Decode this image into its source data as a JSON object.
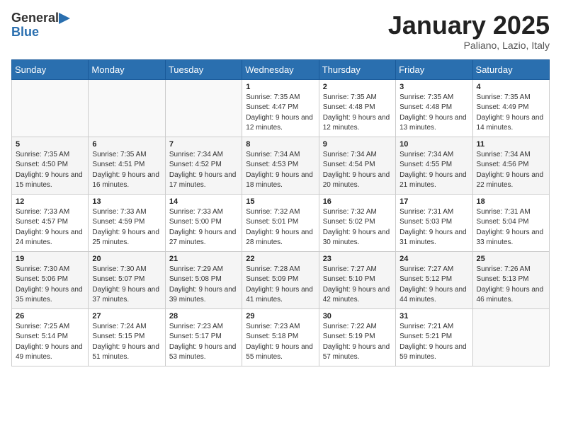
{
  "header": {
    "logo": {
      "general": "General",
      "blue": "Blue"
    },
    "title": "January 2025",
    "subtitle": "Paliano, Lazio, Italy"
  },
  "weekdays": [
    "Sunday",
    "Monday",
    "Tuesday",
    "Wednesday",
    "Thursday",
    "Friday",
    "Saturday"
  ],
  "weeks": [
    [
      {
        "day": "",
        "info": ""
      },
      {
        "day": "",
        "info": ""
      },
      {
        "day": "",
        "info": ""
      },
      {
        "day": "1",
        "info": "Sunrise: 7:35 AM\nSunset: 4:47 PM\nDaylight: 9 hours and 12 minutes."
      },
      {
        "day": "2",
        "info": "Sunrise: 7:35 AM\nSunset: 4:48 PM\nDaylight: 9 hours and 12 minutes."
      },
      {
        "day": "3",
        "info": "Sunrise: 7:35 AM\nSunset: 4:48 PM\nDaylight: 9 hours and 13 minutes."
      },
      {
        "day": "4",
        "info": "Sunrise: 7:35 AM\nSunset: 4:49 PM\nDaylight: 9 hours and 14 minutes."
      }
    ],
    [
      {
        "day": "5",
        "info": "Sunrise: 7:35 AM\nSunset: 4:50 PM\nDaylight: 9 hours and 15 minutes."
      },
      {
        "day": "6",
        "info": "Sunrise: 7:35 AM\nSunset: 4:51 PM\nDaylight: 9 hours and 16 minutes."
      },
      {
        "day": "7",
        "info": "Sunrise: 7:34 AM\nSunset: 4:52 PM\nDaylight: 9 hours and 17 minutes."
      },
      {
        "day": "8",
        "info": "Sunrise: 7:34 AM\nSunset: 4:53 PM\nDaylight: 9 hours and 18 minutes."
      },
      {
        "day": "9",
        "info": "Sunrise: 7:34 AM\nSunset: 4:54 PM\nDaylight: 9 hours and 20 minutes."
      },
      {
        "day": "10",
        "info": "Sunrise: 7:34 AM\nSunset: 4:55 PM\nDaylight: 9 hours and 21 minutes."
      },
      {
        "day": "11",
        "info": "Sunrise: 7:34 AM\nSunset: 4:56 PM\nDaylight: 9 hours and 22 minutes."
      }
    ],
    [
      {
        "day": "12",
        "info": "Sunrise: 7:33 AM\nSunset: 4:57 PM\nDaylight: 9 hours and 24 minutes."
      },
      {
        "day": "13",
        "info": "Sunrise: 7:33 AM\nSunset: 4:59 PM\nDaylight: 9 hours and 25 minutes."
      },
      {
        "day": "14",
        "info": "Sunrise: 7:33 AM\nSunset: 5:00 PM\nDaylight: 9 hours and 27 minutes."
      },
      {
        "day": "15",
        "info": "Sunrise: 7:32 AM\nSunset: 5:01 PM\nDaylight: 9 hours and 28 minutes."
      },
      {
        "day": "16",
        "info": "Sunrise: 7:32 AM\nSunset: 5:02 PM\nDaylight: 9 hours and 30 minutes."
      },
      {
        "day": "17",
        "info": "Sunrise: 7:31 AM\nSunset: 5:03 PM\nDaylight: 9 hours and 31 minutes."
      },
      {
        "day": "18",
        "info": "Sunrise: 7:31 AM\nSunset: 5:04 PM\nDaylight: 9 hours and 33 minutes."
      }
    ],
    [
      {
        "day": "19",
        "info": "Sunrise: 7:30 AM\nSunset: 5:06 PM\nDaylight: 9 hours and 35 minutes."
      },
      {
        "day": "20",
        "info": "Sunrise: 7:30 AM\nSunset: 5:07 PM\nDaylight: 9 hours and 37 minutes."
      },
      {
        "day": "21",
        "info": "Sunrise: 7:29 AM\nSunset: 5:08 PM\nDaylight: 9 hours and 39 minutes."
      },
      {
        "day": "22",
        "info": "Sunrise: 7:28 AM\nSunset: 5:09 PM\nDaylight: 9 hours and 41 minutes."
      },
      {
        "day": "23",
        "info": "Sunrise: 7:27 AM\nSunset: 5:10 PM\nDaylight: 9 hours and 42 minutes."
      },
      {
        "day": "24",
        "info": "Sunrise: 7:27 AM\nSunset: 5:12 PM\nDaylight: 9 hours and 44 minutes."
      },
      {
        "day": "25",
        "info": "Sunrise: 7:26 AM\nSunset: 5:13 PM\nDaylight: 9 hours and 46 minutes."
      }
    ],
    [
      {
        "day": "26",
        "info": "Sunrise: 7:25 AM\nSunset: 5:14 PM\nDaylight: 9 hours and 49 minutes."
      },
      {
        "day": "27",
        "info": "Sunrise: 7:24 AM\nSunset: 5:15 PM\nDaylight: 9 hours and 51 minutes."
      },
      {
        "day": "28",
        "info": "Sunrise: 7:23 AM\nSunset: 5:17 PM\nDaylight: 9 hours and 53 minutes."
      },
      {
        "day": "29",
        "info": "Sunrise: 7:23 AM\nSunset: 5:18 PM\nDaylight: 9 hours and 55 minutes."
      },
      {
        "day": "30",
        "info": "Sunrise: 7:22 AM\nSunset: 5:19 PM\nDaylight: 9 hours and 57 minutes."
      },
      {
        "day": "31",
        "info": "Sunrise: 7:21 AM\nSunset: 5:21 PM\nDaylight: 9 hours and 59 minutes."
      },
      {
        "day": "",
        "info": ""
      }
    ]
  ]
}
